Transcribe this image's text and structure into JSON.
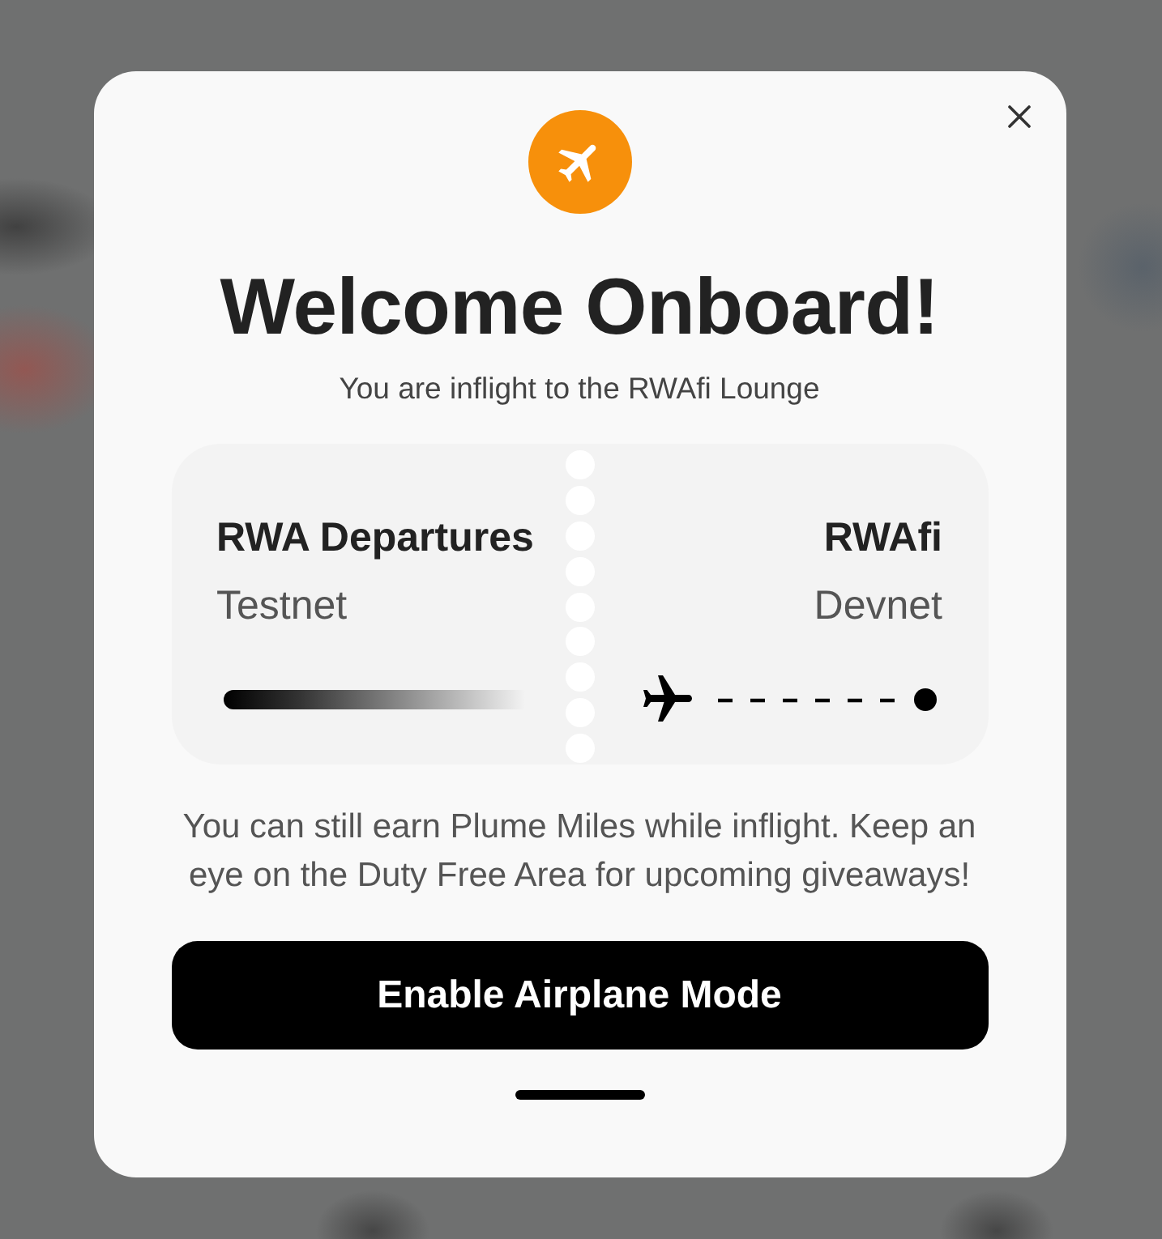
{
  "dialog": {
    "title": "Welcome Onboard!",
    "subtitle": "You are inflight to the RWAfi Lounge",
    "ticket": {
      "origin": {
        "name": "RWA Departures",
        "network": "Testnet"
      },
      "destination": {
        "name": "RWAfi",
        "network": "Devnet"
      }
    },
    "message": "You can still earn Plume Miles while inflight. Keep an eye on the Duty Free Area for upcoming giveaways!",
    "primary_button": "Enable Airplane Mode"
  }
}
